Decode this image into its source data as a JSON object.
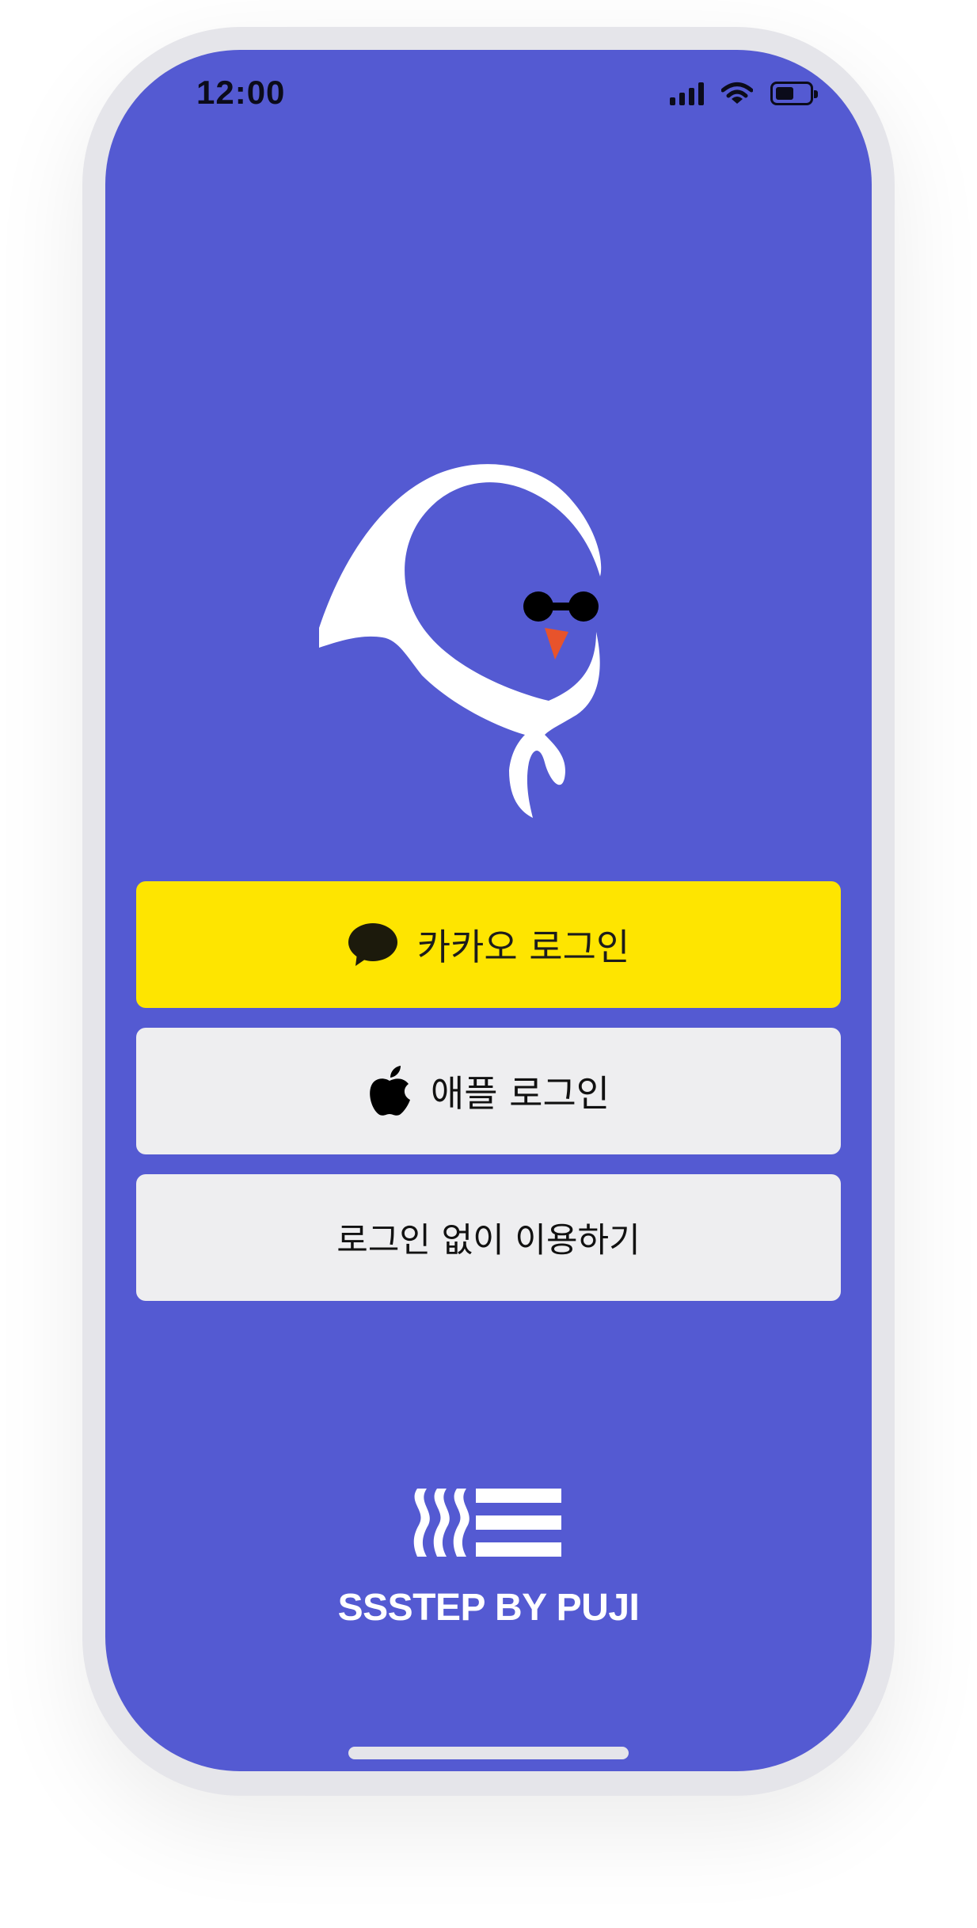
{
  "status_bar": {
    "time": "12:00",
    "icons": [
      "cellular-signal-icon",
      "wifi-icon",
      "battery-icon"
    ]
  },
  "mascot": {
    "icon": "bird-mascot-with-white-scarf"
  },
  "login": {
    "kakao_label": "카카오 로그인",
    "kakao_icon": "kakao-speech-bubble-icon",
    "apple_label": "애플 로그인",
    "apple_icon": "apple-icon",
    "guest_label": "로그인 없이 이용하기"
  },
  "brand": {
    "logo_icon": "ssstep-logo",
    "text": "SSSTEP BY PUJI"
  },
  "colors": {
    "background": "#545ad2",
    "kakao": "#fee500",
    "button_light": "#eeeef0",
    "frame": "#e5e5ea",
    "beak": "#e8532b"
  }
}
